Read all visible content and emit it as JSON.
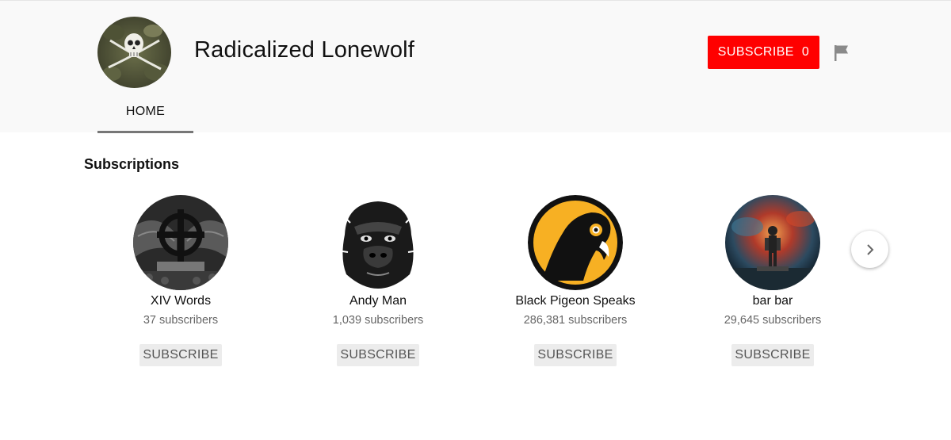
{
  "channel": {
    "title": "Radicalized Lonewolf",
    "avatar_icon": "skull-crossed-swords-avatar"
  },
  "header": {
    "subscribe_label": "SUBSCRIBE",
    "subscribe_count": "0",
    "subscribe_color": "#ff0000",
    "flag_icon": "flag-icon"
  },
  "tabs": [
    {
      "label": "HOME",
      "active": true
    }
  ],
  "section": {
    "title": "Subscriptions"
  },
  "subscriptions": [
    {
      "name": "XIV Words",
      "subscribers": "37 subscribers",
      "button": "SUBSCRIBE",
      "avatar_icon": "celtic-cross-avatar"
    },
    {
      "name": "Andy Man",
      "subscribers": "1,039 subscribers",
      "button": "SUBSCRIBE",
      "avatar_icon": "gorilla-avatar"
    },
    {
      "name": "Black Pigeon Speaks",
      "subscribers": "286,381 subscribers",
      "button": "SUBSCRIBE",
      "avatar_icon": "black-pigeon-avatar"
    },
    {
      "name": "bar bar",
      "subscribers": "29,645 subscribers",
      "button": "SUBSCRIBE",
      "avatar_icon": "space-figure-avatar"
    }
  ],
  "carousel": {
    "next_icon": "chevron-right-icon"
  }
}
